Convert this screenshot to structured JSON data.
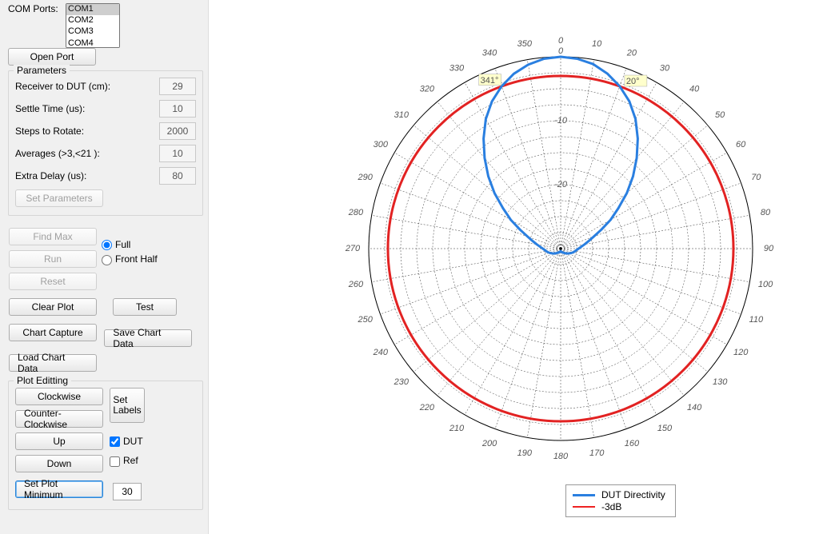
{
  "left": {
    "com_ports_label": "COM Ports:",
    "com_list": [
      "COM1",
      "COM2",
      "COM3",
      "COM4"
    ],
    "open_port": "Open Port",
    "parameters": {
      "title": "Parameters",
      "rows": [
        {
          "label": "Receiver to DUT (cm):",
          "value": "29"
        },
        {
          "label": "Settle Time (us):",
          "value": "10"
        },
        {
          "label": "Steps to Rotate:",
          "value": "2000"
        },
        {
          "label": "Averages (>3,<21 ):",
          "value": "10"
        },
        {
          "label": "Extra Delay (us):",
          "value": "80"
        }
      ],
      "set_parameters": "Set Parameters"
    },
    "find_max": "Find Max",
    "run": "Run",
    "reset": "Reset",
    "full": "Full",
    "front_half": "Front Half",
    "clear_plot": "Clear Plot",
    "test": "Test",
    "chart_capture": "Chart Capture",
    "save_chart_data": "Save Chart Data",
    "load_chart_data": "Load Chart Data",
    "plot_editing": {
      "title": "Plot Editting",
      "clockwise": "Clockwise",
      "ccw": "Counter-Clockwise",
      "up": "Up",
      "down": "Down",
      "set_labels": "Set\nLabels",
      "dut": "DUT",
      "ref": "Ref",
      "set_plot_min": "Set Plot Minimum",
      "plot_min_value": "30"
    }
  },
  "legend": {
    "dut": "DUT Directivity",
    "m3db": "-3dB"
  },
  "markers": {
    "left": "341°",
    "right": "20°"
  },
  "chart_data": {
    "type": "polar",
    "title": "",
    "series": [
      {
        "name": "-3dB",
        "kind": "threshold",
        "constant_value_dB": -3,
        "color": "#e22222"
      },
      {
        "name": "DUT Directivity",
        "color": "#2a7fe0",
        "categories_deg": [
          0,
          5,
          10,
          15,
          20,
          25,
          30,
          35,
          40,
          45,
          50,
          55,
          60,
          65,
          70,
          75,
          80,
          85,
          90,
          95,
          100,
          105,
          110,
          115,
          120,
          125,
          130,
          135,
          140,
          145,
          150,
          155,
          160,
          165,
          170,
          175,
          180,
          185,
          190,
          195,
          200,
          205,
          210,
          215,
          220,
          225,
          230,
          235,
          240,
          245,
          250,
          255,
          260,
          265,
          270,
          275,
          280,
          285,
          290,
          295,
          300,
          305,
          310,
          315,
          320,
          325,
          330,
          335,
          340,
          345,
          350,
          355
        ],
        "values_dB": [
          0,
          -0.2,
          -0.7,
          -1.7,
          -3,
          -4.6,
          -6.6,
          -9,
          -11.5,
          -14,
          -16.5,
          -19,
          -21,
          -23,
          -24.5,
          -25.5,
          -26.2,
          -26.8,
          -27.2,
          -27.5,
          -27.7,
          -27.9,
          -28.1,
          -28.3,
          -28.5,
          -28.7,
          -28.8,
          -29,
          -29.1,
          -29.2,
          -29.3,
          -29.3,
          -29.4,
          -29.5,
          -29.5,
          -29.6,
          -29.6,
          -29.6,
          -29.5,
          -29.5,
          -29.4,
          -29.3,
          -29.3,
          -29.2,
          -29.1,
          -29,
          -28.8,
          -28.7,
          -28.5,
          -28.3,
          -28.1,
          -27.9,
          -27.7,
          -27.5,
          -27.2,
          -26.8,
          -26.2,
          -25.5,
          -24.5,
          -23,
          -21,
          -19,
          -16.5,
          -14,
          -11.5,
          -9,
          -6.6,
          -4.6,
          -3,
          -1.7,
          -0.8,
          -0.2
        ]
      }
    ],
    "angle_range_deg": [
      0,
      360
    ],
    "angle_tick_step_deg": 10,
    "radial_axis_dB": {
      "min": -30,
      "max": 0,
      "ticks": [
        -10,
        -20
      ]
    },
    "legend_position": "bottom",
    "annotations": [
      {
        "text": "341°",
        "angle_deg": 341,
        "value_dB": -3
      },
      {
        "text": "20°",
        "angle_deg": 20,
        "value_dB": -3
      }
    ],
    "ylabel": "",
    "xlabel": ""
  }
}
